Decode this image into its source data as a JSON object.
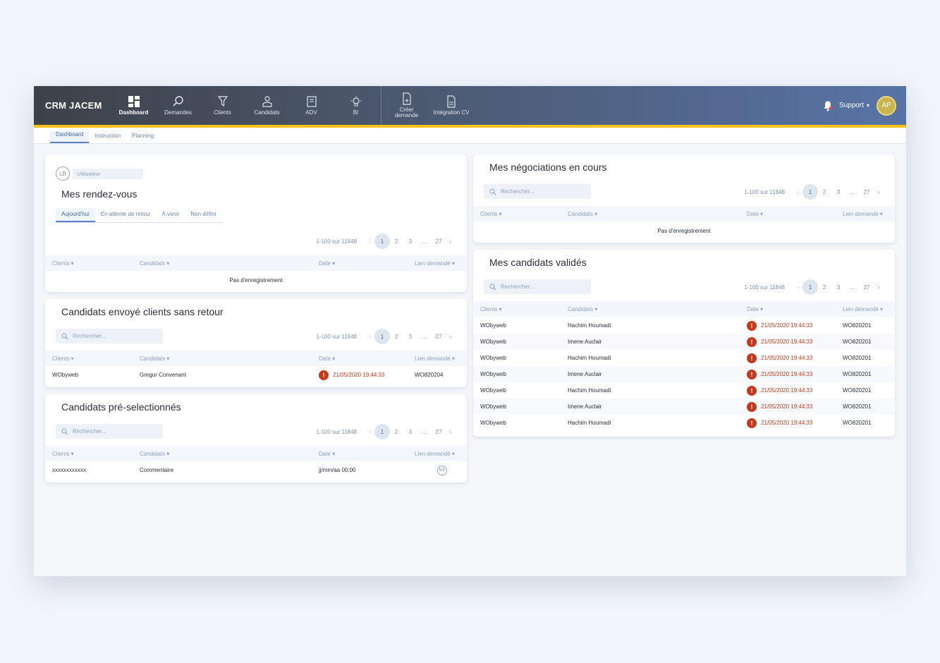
{
  "app": {
    "title": "CRM JACEM"
  },
  "nav": [
    {
      "label": "Dashboard",
      "icon": "dashboard-icon",
      "active": true
    },
    {
      "label": "Demandes",
      "icon": "search-icon"
    },
    {
      "label": "Clients",
      "icon": "funnel-icon"
    },
    {
      "label": "Candidats",
      "icon": "person-icon"
    },
    {
      "label": "ADV",
      "icon": "book-icon"
    },
    {
      "label": "BI",
      "icon": "lightbulb-icon"
    }
  ],
  "nav_actions": [
    {
      "label": "Créer demande",
      "icon": "new-document-icon"
    },
    {
      "label": "Intégration CV",
      "icon": "cv-document-icon"
    }
  ],
  "user_menu": {
    "label": "Support",
    "initials": "AP"
  },
  "subnav": [
    "Dashboard",
    "Instruction",
    "Planning"
  ],
  "columns": [
    "Clients",
    "Candidats",
    "Date",
    "Lien demandé"
  ],
  "pager": {
    "range": "1-100 sur 11848",
    "pages": [
      "1",
      "2",
      "3",
      "...",
      "27"
    ],
    "prev": "‹",
    "next": "›"
  },
  "search_placeholder": "Rechercher...",
  "empty_text": "Pas d'enregistrement",
  "rdv": {
    "user_initials": "LB",
    "user_label": "Utilisateur",
    "title": "Mes rendez-vous",
    "tabs": [
      "Aujourd'hui",
      "En attente de retour",
      "À venir",
      "Non défini"
    ]
  },
  "sans_retour": {
    "title": "Candidats envoyé clients sans retour",
    "rows": [
      {
        "client": "WObyweb",
        "candidat": "Gregor Convenant",
        "date": "21/05/2020  19:44:33",
        "lien": "WO820204"
      }
    ]
  },
  "preselect": {
    "title": "Candidats pré-selectionnés",
    "rows": [
      {
        "client": "xxxxxxxxxxxx",
        "candidat": "Commentaire",
        "date": "jj/mm/aa 00:00",
        "lien": "MZ"
      }
    ]
  },
  "negociations": {
    "title": "Mes négociations en cours"
  },
  "valides": {
    "title": "Mes candidats validés",
    "rows": [
      {
        "client": "WObyweb",
        "candidat": "Hachim Houmadi",
        "date": "21/05/2020  19:44:33",
        "lien": "WO820201"
      },
      {
        "client": "WObyweb",
        "candidat": "Imene Auclair",
        "date": "21/05/2020  19:44:33",
        "lien": "WO820201"
      },
      {
        "client": "WObyweb",
        "candidat": "Hachim Houmadi",
        "date": "21/05/2020  19:44:33",
        "lien": "WO820201"
      },
      {
        "client": "WObyweb",
        "candidat": "Imene Auclair",
        "date": "21/05/2020  19:44:33",
        "lien": "WO820201"
      },
      {
        "client": "WObyweb",
        "candidat": "Hachim Houmadi",
        "date": "21/05/2020  19:44:33",
        "lien": "WO820201"
      },
      {
        "client": "WObyweb",
        "candidat": "Imene Auclair",
        "date": "21/05/2020  19:44:33",
        "lien": "WO820201"
      },
      {
        "client": "WObyweb",
        "candidat": "Hachim Houmadi",
        "date": "21/05/2020  19:44:33",
        "lien": "WO820201"
      }
    ]
  },
  "colors": {
    "accent": "#5a7fc4",
    "alert": "#c7391c",
    "highlight": "#f2c21b"
  }
}
